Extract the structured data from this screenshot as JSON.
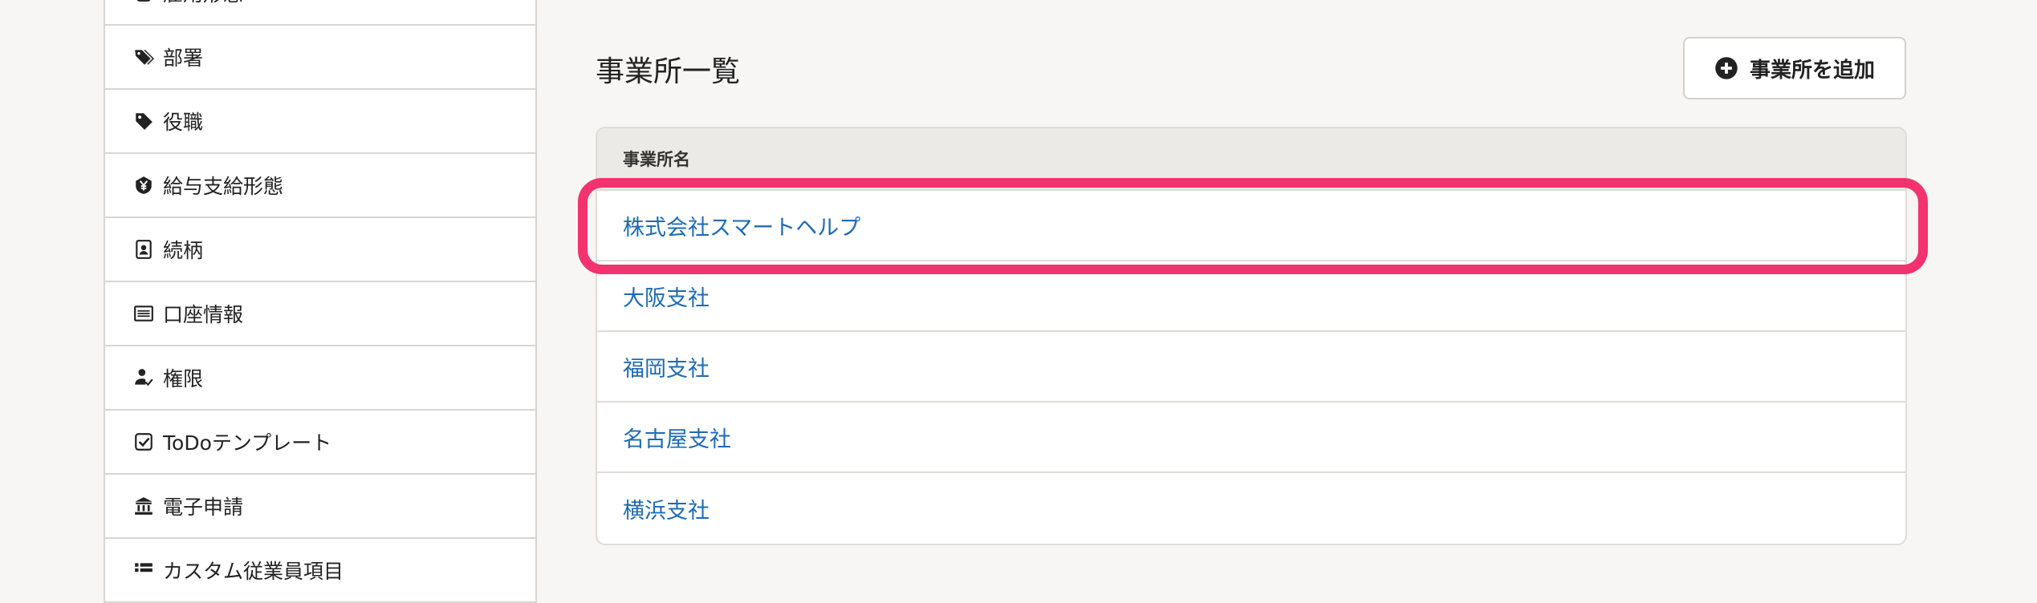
{
  "sidebar": {
    "items": [
      {
        "label": "雇用形態",
        "icon": "clipboard-icon"
      },
      {
        "label": "部署",
        "icon": "tags-icon"
      },
      {
        "label": "役職",
        "icon": "tag-icon"
      },
      {
        "label": "給与支給形態",
        "icon": "yen-badge-icon"
      },
      {
        "label": "続柄",
        "icon": "contact-card-icon"
      },
      {
        "label": "口座情報",
        "icon": "bank-card-list-icon"
      },
      {
        "label": "権限",
        "icon": "user-check-icon"
      },
      {
        "label": "ToDoテンプレート",
        "icon": "checkbox-icon"
      },
      {
        "label": "電子申請",
        "icon": "government-building-icon"
      },
      {
        "label": "カスタム従業員項目",
        "icon": "list-icon"
      }
    ]
  },
  "main": {
    "title": "事業所一覧",
    "add_button_label": "事業所を追加",
    "table": {
      "header": "事業所名",
      "rows": [
        "株式会社スマートヘルプ",
        "大阪支社",
        "福岡支社",
        "名古屋支社",
        "横浜支社"
      ]
    }
  },
  "colors": {
    "link": "#1d6bb3",
    "highlight": "#f2336f",
    "background": "#f7f6f4"
  }
}
